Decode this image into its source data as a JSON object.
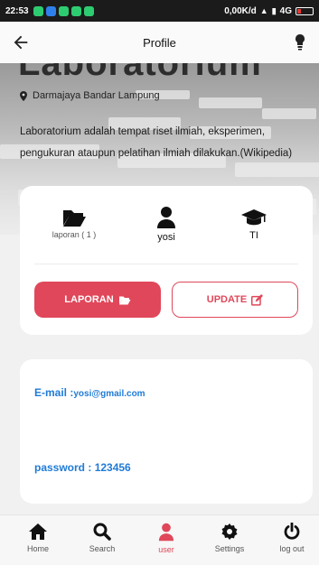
{
  "status_bar": {
    "time": "22:53",
    "network": "0,00K/d",
    "signal": "4G",
    "battery_color": "#e53935",
    "app_icon_colors": [
      "#2ecc71",
      "#2f80ed",
      "#2ecc71",
      "#2ecc71",
      "#2ecc71"
    ]
  },
  "appbar": {
    "title": "Profile",
    "back_icon": "arrow-left-icon",
    "right_icon": "lightbulb-icon"
  },
  "hero": {
    "title": "Laboratorium",
    "location": "Darmajaya Bandar Lampung",
    "description": "Laboratorium adalah tempat riset ilmiah, eksperimen, pengukuran ataupun pelatihan ilmiah dilakukan.(Wikipedia)"
  },
  "stats": {
    "laporan_label": "laporan ( 1 )",
    "user_name": "yosi",
    "major": "TI"
  },
  "buttons": {
    "laporan": "LAPORAN",
    "update": "UPDATE"
  },
  "info": {
    "email_label": "E-mail :",
    "email_value": "yosi@gmail.com",
    "password_label": "password : ",
    "password_value": "123456"
  },
  "bottom_nav": [
    {
      "label": "Home",
      "icon": "home-icon"
    },
    {
      "label": "Search",
      "icon": "search-icon"
    },
    {
      "label": "user",
      "icon": "user-icon"
    },
    {
      "label": "Settings",
      "icon": "gear-icon"
    },
    {
      "label": "log out",
      "icon": "power-icon"
    }
  ],
  "colors": {
    "accent": "#e0475a",
    "link": "#1f7bd6"
  }
}
